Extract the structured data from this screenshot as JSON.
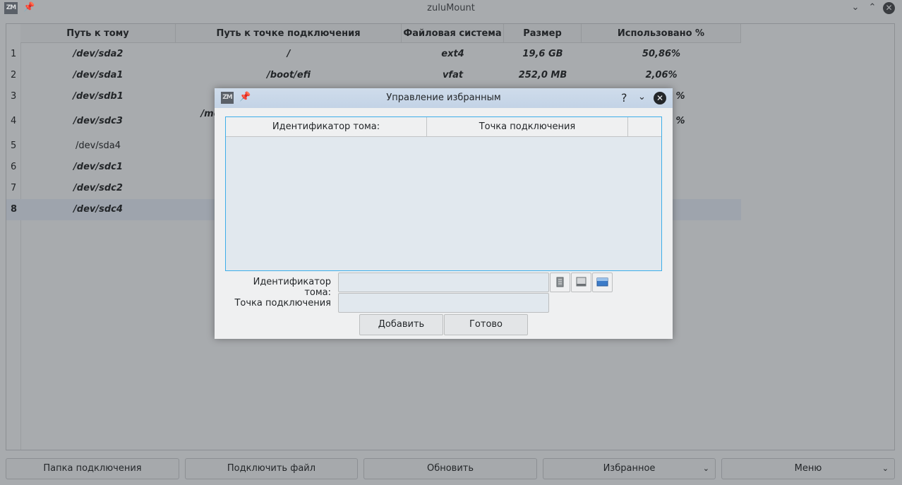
{
  "window": {
    "title": "zuluMount",
    "logo_text": "ZM"
  },
  "table": {
    "headers": [
      "Путь к тому",
      "Путь к точке подключения",
      "Файловая система",
      "Размер",
      "Использовано %"
    ],
    "rows": [
      {
        "num": "1",
        "volume": "/dev/sda2",
        "mount": "/",
        "fs": "ext4",
        "size": "19,6 GB",
        "used": "50,86%"
      },
      {
        "num": "2",
        "volume": "/dev/sda1",
        "mount": "/boot/efi",
        "fs": "vfat",
        "size": "252,0 MB",
        "used": "2,06%"
      },
      {
        "num": "3",
        "volume": "/dev/sdb1",
        "mount": "",
        "fs": "",
        "size": "",
        "used": "%"
      },
      {
        "num": "4",
        "volume": "/dev/sdc3",
        "mount": "/me",
        "fs": "",
        "size": "",
        "used": "%"
      },
      {
        "num": "5",
        "volume": "/dev/sda4",
        "mount": "",
        "fs": "",
        "size": "",
        "used": ""
      },
      {
        "num": "6",
        "volume": "/dev/sdc1",
        "mount": "",
        "fs": "",
        "size": "",
        "used": ""
      },
      {
        "num": "7",
        "volume": "/dev/sdc2",
        "mount": "",
        "fs": "",
        "size": "",
        "used": ""
      },
      {
        "num": "8",
        "volume": "/dev/sdc4",
        "mount": "",
        "fs": "",
        "size": "",
        "used": ""
      }
    ],
    "selected_row": "8"
  },
  "bottom_buttons": {
    "mount_folder": "Папка подключения",
    "mount_file": "Подключить файл",
    "refresh": "Обновить",
    "favorites": "Избранное",
    "menu": "Меню"
  },
  "dialog": {
    "title": "Управление избранным",
    "logo_text": "ZM",
    "table_headers": [
      "Идентификатор тома:",
      "Точка подключения"
    ],
    "volume_id_label": "Идентификатор тома:",
    "mount_point_label": "Точка подключения",
    "volume_id_value": "",
    "mount_point_value": "",
    "add_button": "Добавить",
    "done_button": "Готово"
  },
  "icons": {
    "pin": "pin-icon",
    "help": "help-icon",
    "minimize": "chevron-down-icon",
    "maximize": "chevron-up-icon",
    "close": "close-icon",
    "file": "file-icon",
    "drive": "drive-icon",
    "partition": "partition-icon"
  }
}
